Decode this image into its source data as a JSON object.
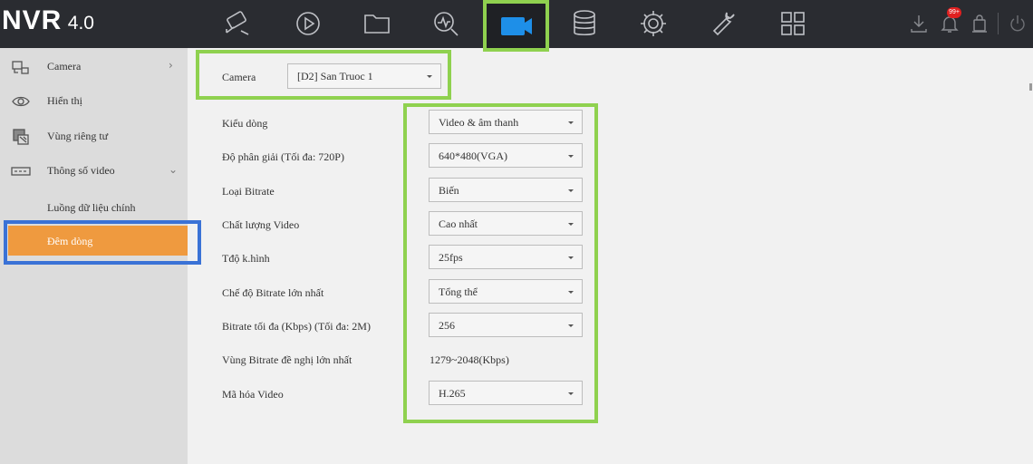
{
  "app": {
    "brand": "NVR",
    "version": "4.0"
  },
  "top_nav": {
    "icons": [
      "alarm-camera-icon",
      "playback-icon",
      "folder-icon",
      "search-analysis-icon",
      "camera-icon",
      "storage-icon",
      "settings-icon",
      "maintenance-icon",
      "grid-view-icon"
    ],
    "active": "camera-icon",
    "notification_badge": "99+"
  },
  "sidebar": {
    "items": [
      {
        "label": "Camera",
        "icon": "camera-settings-icon",
        "chevron": "›"
      },
      {
        "label": "Hiển thị",
        "icon": "eye-icon"
      },
      {
        "label": "Vùng riêng tư",
        "icon": "privacy-icon"
      },
      {
        "label": "Thông số video",
        "icon": "video-params-icon",
        "chevron": "⌄"
      }
    ],
    "sub_items": [
      {
        "label": "Luồng dữ liệu chính"
      },
      {
        "label": "Đêm dòng",
        "active": true
      }
    ]
  },
  "form": {
    "camera": {
      "label": "Camera",
      "value": "[D2] San Truoc 1"
    },
    "fields": [
      {
        "label": "Kiểu dòng",
        "value": "Video & âm thanh",
        "type": "select"
      },
      {
        "label": "Độ phân giải (Tối đa: 720P)",
        "value": "640*480(VGA)",
        "type": "select"
      },
      {
        "label": "Loại Bitrate",
        "value": "Biến",
        "type": "select"
      },
      {
        "label": "Chất lượng Video",
        "value": "Cao nhất",
        "type": "select"
      },
      {
        "label": "Tđộ k.hình",
        "value": "25fps",
        "type": "select"
      },
      {
        "label": "Chế độ Bitrate lớn nhất",
        "value": "Tổng thể",
        "type": "select"
      },
      {
        "label": "Bitrate tối đa (Kbps) (Tối đa: 2M)",
        "value": "256",
        "type": "select"
      },
      {
        "label": "Vùng Bitrate đề nghị lớn nhất",
        "value": "1279~2048(Kbps)",
        "type": "text"
      },
      {
        "label": "Mã hóa Video",
        "value": "H.265",
        "type": "select"
      }
    ]
  },
  "colors": {
    "topbar": "#2a2c31",
    "highlight_green": "#8fd14f",
    "highlight_blue": "#3a72d6",
    "active_orange": "#ef9a3f",
    "accent_blue": "#1e8fe8"
  }
}
